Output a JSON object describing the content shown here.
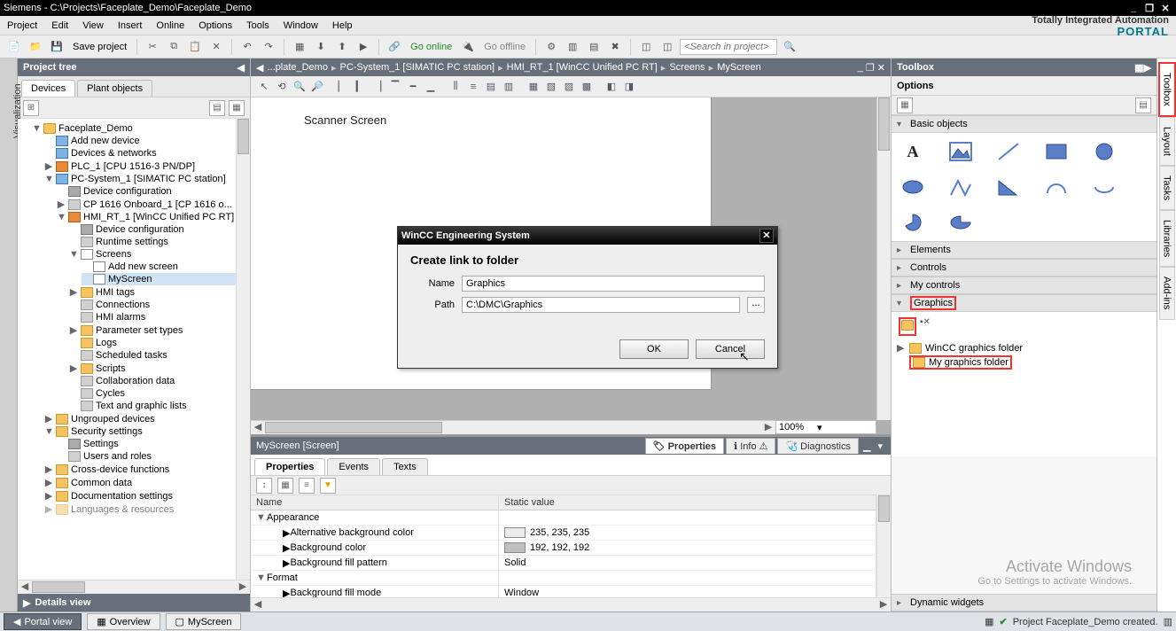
{
  "window": {
    "title": "Siemens  -  C:\\Projects\\Faceplate_Demo\\Faceplate_Demo",
    "minimize": "_",
    "restore": "❐",
    "close": "✕"
  },
  "menu": {
    "items": [
      "Project",
      "Edit",
      "View",
      "Insert",
      "Online",
      "Options",
      "Tools",
      "Window",
      "Help"
    ],
    "branding1": "Totally Integrated Automation",
    "branding2": "PORTAL"
  },
  "toolbar": {
    "save_label": "Save project",
    "go_online": "Go online",
    "go_offline": "Go offline",
    "search_placeholder": "<Search in project>"
  },
  "left": {
    "side_tab": "Visualization",
    "header": "Project tree",
    "tabs": {
      "devices": "Devices",
      "plant": "Plant objects"
    },
    "details": "Details view"
  },
  "tree": {
    "root": "Faceplate_Demo",
    "add_device": "Add new device",
    "devices_networks": "Devices & networks",
    "plc": "PLC_1 [CPU 1516-3 PN/DP]",
    "pc": "PC-System_1 [SIMATIC PC station]",
    "dev_conf": "Device configuration",
    "cp": "CP 1616 Onboard_1 [CP 1616 o...",
    "hmi": "HMI_RT_1 [WinCC Unified PC RT]",
    "dev_conf2": "Device configuration",
    "runtime": "Runtime settings",
    "screens": "Screens",
    "add_screen": "Add new screen",
    "myscreen": "MyScreen",
    "hmi_tags": "HMI tags",
    "connections": "Connections",
    "hmi_alarms": "HMI alarms",
    "param_set": "Parameter set types",
    "logs": "Logs",
    "sched": "Scheduled tasks",
    "scripts": "Scripts",
    "collab": "Collaboration data",
    "cycles": "Cycles",
    "textgraphic": "Text and graphic lists",
    "ungrouped": "Ungrouped devices",
    "security": "Security settings",
    "settings": "Settings",
    "users": "Users and roles",
    "crossdev": "Cross-device functions",
    "common": "Common data",
    "docset": "Documentation settings",
    "lang": "Languages & resources"
  },
  "breadcrumb": {
    "parts": [
      "...plate_Demo",
      "PC-System_1 [SIMATIC PC station]",
      "HMI_RT_1 [WinCC Unified PC RT]",
      "Screens",
      "MyScreen"
    ]
  },
  "canvas": {
    "screen_title": "Scanner Screen",
    "zoom": "100%"
  },
  "dialog": {
    "title": "WinCC Engineering System",
    "heading": "Create link to folder",
    "name_label": "Name",
    "name_value": "Graphics",
    "path_label": "Path",
    "path_value": "C:\\DMC\\Graphics",
    "browse": "...",
    "ok": "OK",
    "cancel": "Cancel"
  },
  "props": {
    "title": "MyScreen [Screen]",
    "tab_properties": "Properties",
    "tab_info": "Info",
    "tab_diag": "Diagnostics",
    "sub_properties": "Properties",
    "sub_events": "Events",
    "sub_texts": "Texts",
    "col_name": "Name",
    "col_val": "Static value",
    "grp_appearance": "Appearance",
    "row_altbg": "Alternative background color",
    "row_altbg_val": "235, 235, 235",
    "row_bg": "Background color",
    "row_bg_val": "192, 192, 192",
    "row_fillpat": "Background fill pattern",
    "row_fillpat_val": "Solid",
    "grp_format": "Format",
    "row_fillmode": "Background fill mode",
    "row_fillmode_val": "Window"
  },
  "toolbox": {
    "header": "Toolbox",
    "options": "Options",
    "sec_basic": "Basic objects",
    "sec_elements": "Elements",
    "sec_controls": "Controls",
    "sec_mycontrols": "My controls",
    "sec_graphics": "Graphics",
    "sec_dynwidgets": "Dynamic widgets",
    "wincc_folder": "WinCC graphics folder",
    "my_folder": "My graphics folder",
    "vtabs": [
      "Toolbox",
      "Layout",
      "Tasks",
      "Libraries",
      "Add-ins"
    ]
  },
  "status": {
    "portal": "Portal view",
    "overview": "Overview",
    "myscreen": "MyScreen",
    "msg": "Project Faceplate_Demo created."
  },
  "watermark": {
    "l1": "Activate Windows",
    "l2": "Go to Settings to activate Windows."
  }
}
